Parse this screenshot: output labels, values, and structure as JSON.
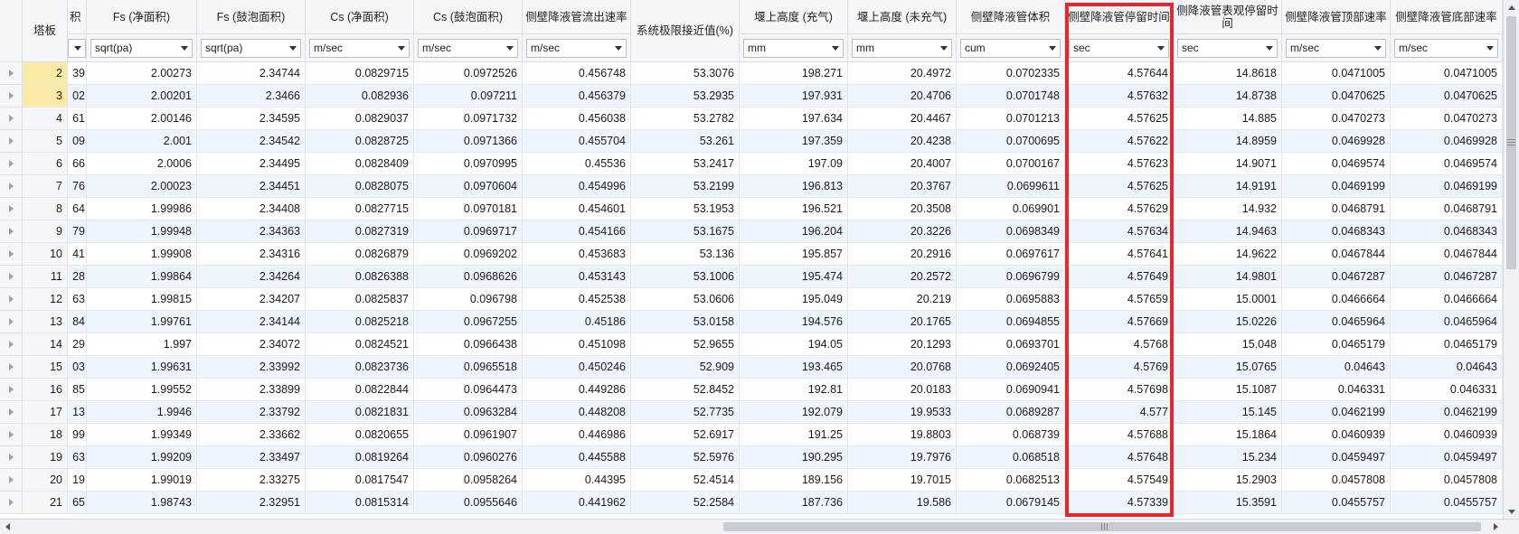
{
  "grid": {
    "tray_header": "塔板",
    "columns": [
      {
        "id": "c0",
        "label": "积",
        "unit": ""
      },
      {
        "id": "c1",
        "label": "Fs (净面积)",
        "unit": "sqrt(pa)"
      },
      {
        "id": "c2",
        "label": "Fs (鼓泡面积)",
        "unit": "sqrt(pa)"
      },
      {
        "id": "c3",
        "label": "Cs (净面积)",
        "unit": "m/sec"
      },
      {
        "id": "c4",
        "label": "Cs (鼓泡面积)",
        "unit": "m/sec"
      },
      {
        "id": "c5",
        "label": "侧壁降液管流出速率",
        "unit": "m/sec"
      },
      {
        "id": "c6",
        "label": "系统极限接近值(%)",
        "unit": ""
      },
      {
        "id": "c7",
        "label": "堰上高度 (充气)",
        "unit": "mm"
      },
      {
        "id": "c8",
        "label": "堰上高度 (未充气)",
        "unit": "mm"
      },
      {
        "id": "c9",
        "label": "侧壁降液管体积",
        "unit": "cum"
      },
      {
        "id": "c10",
        "label": "侧壁降液管停留时间",
        "unit": "sec"
      },
      {
        "id": "c11",
        "label": "侧降液管表观停留时间",
        "unit": "sec"
      },
      {
        "id": "c12",
        "label": "侧壁降液管顶部速率",
        "unit": "m/sec"
      },
      {
        "id": "c13",
        "label": "侧壁降液管底部速率",
        "unit": "m/sec"
      }
    ],
    "rows": [
      {
        "tray": "2",
        "v": [
          "39",
          "2.00273",
          "2.34744",
          "0.0829715",
          "0.0972526",
          "0.456748",
          "53.3076",
          "198.271",
          "20.4972",
          "0.0702335",
          "4.57644",
          "14.8618",
          "0.0471005",
          "0.0471005"
        ]
      },
      {
        "tray": "3",
        "v": [
          "02",
          "2.00201",
          "2.3466",
          "0.082936",
          "0.097211",
          "0.456379",
          "53.2935",
          "197.931",
          "20.4706",
          "0.0701748",
          "4.57632",
          "14.8738",
          "0.0470625",
          "0.0470625"
        ]
      },
      {
        "tray": "4",
        "v": [
          "61",
          "2.00146",
          "2.34595",
          "0.0829037",
          "0.0971732",
          "0.456038",
          "53.2782",
          "197.634",
          "20.4467",
          "0.0701213",
          "4.57625",
          "14.885",
          "0.0470273",
          "0.0470273"
        ]
      },
      {
        "tray": "5",
        "v": [
          "09",
          "2.001",
          "2.34542",
          "0.0828725",
          "0.0971366",
          "0.455704",
          "53.261",
          "197.359",
          "20.4238",
          "0.0700695",
          "4.57622",
          "14.8959",
          "0.0469928",
          "0.0469928"
        ]
      },
      {
        "tray": "6",
        "v": [
          "66",
          "2.0006",
          "2.34495",
          "0.0828409",
          "0.0970995",
          "0.45536",
          "53.2417",
          "197.09",
          "20.4007",
          "0.0700167",
          "4.57623",
          "14.9071",
          "0.0469574",
          "0.0469574"
        ]
      },
      {
        "tray": "7",
        "v": [
          "76",
          "2.00023",
          "2.34451",
          "0.0828075",
          "0.0970604",
          "0.454996",
          "53.2199",
          "196.813",
          "20.3767",
          "0.0699611",
          "4.57625",
          "14.9191",
          "0.0469199",
          "0.0469199"
        ]
      },
      {
        "tray": "8",
        "v": [
          "64",
          "1.99986",
          "2.34408",
          "0.0827715",
          "0.0970181",
          "0.454601",
          "53.1953",
          "196.521",
          "20.3508",
          "0.069901",
          "4.57629",
          "14.932",
          "0.0468791",
          "0.0468791"
        ]
      },
      {
        "tray": "9",
        "v": [
          "79",
          "1.99948",
          "2.34363",
          "0.0827319",
          "0.0969717",
          "0.454166",
          "53.1675",
          "196.204",
          "20.3226",
          "0.0698349",
          "4.57634",
          "14.9463",
          "0.0468343",
          "0.0468343"
        ]
      },
      {
        "tray": "10",
        "v": [
          "41",
          "1.99908",
          "2.34316",
          "0.0826879",
          "0.0969202",
          "0.453683",
          "53.136",
          "195.857",
          "20.2916",
          "0.0697617",
          "4.57641",
          "14.9622",
          "0.0467844",
          "0.0467844"
        ]
      },
      {
        "tray": "11",
        "v": [
          "28",
          "1.99864",
          "2.34264",
          "0.0826388",
          "0.0968626",
          "0.453143",
          "53.1006",
          "195.474",
          "20.2572",
          "0.0696799",
          "4.57649",
          "14.9801",
          "0.0467287",
          "0.0467287"
        ]
      },
      {
        "tray": "12",
        "v": [
          "63",
          "1.99815",
          "2.34207",
          "0.0825837",
          "0.096798",
          "0.452538",
          "53.0606",
          "195.049",
          "20.219",
          "0.0695883",
          "4.57659",
          "15.0001",
          "0.0466664",
          "0.0466664"
        ]
      },
      {
        "tray": "13",
        "v": [
          "84",
          "1.99761",
          "2.34144",
          "0.0825218",
          "0.0967255",
          "0.45186",
          "53.0158",
          "194.576",
          "20.1765",
          "0.0694855",
          "4.57669",
          "15.0226",
          "0.0465964",
          "0.0465964"
        ]
      },
      {
        "tray": "14",
        "v": [
          "29",
          "1.997",
          "2.34072",
          "0.0824521",
          "0.0966438",
          "0.451098",
          "52.9655",
          "194.05",
          "20.1293",
          "0.0693701",
          "4.5768",
          "15.048",
          "0.0465179",
          "0.0465179"
        ]
      },
      {
        "tray": "15",
        "v": [
          "03",
          "1.99631",
          "2.33992",
          "0.0823736",
          "0.0965518",
          "0.450246",
          "52.909",
          "193.465",
          "20.0768",
          "0.0692405",
          "4.5769",
          "15.0765",
          "0.04643",
          "0.04643"
        ]
      },
      {
        "tray": "16",
        "v": [
          "85",
          "1.99552",
          "2.33899",
          "0.0822844",
          "0.0964473",
          "0.449286",
          "52.8452",
          "192.81",
          "20.0183",
          "0.0690941",
          "4.57698",
          "15.1087",
          "0.046331",
          "0.046331"
        ]
      },
      {
        "tray": "17",
        "v": [
          "13",
          "1.9946",
          "2.33792",
          "0.0821831",
          "0.0963284",
          "0.448208",
          "52.7735",
          "192.079",
          "19.9533",
          "0.0689287",
          "4.577",
          "15.145",
          "0.0462199",
          "0.0462199"
        ]
      },
      {
        "tray": "18",
        "v": [
          "99",
          "1.99349",
          "2.33662",
          "0.0820655",
          "0.0961907",
          "0.446986",
          "52.6917",
          "191.25",
          "19.8803",
          "0.068739",
          "4.57688",
          "15.1864",
          "0.0460939",
          "0.0460939"
        ]
      },
      {
        "tray": "19",
        "v": [
          "63",
          "1.99209",
          "2.33497",
          "0.0819264",
          "0.0960276",
          "0.445588",
          "52.5976",
          "190.295",
          "19.7976",
          "0.068518",
          "4.57648",
          "15.234",
          "0.0459497",
          "0.0459497"
        ]
      },
      {
        "tray": "20",
        "v": [
          "19",
          "1.99019",
          "2.33275",
          "0.0817547",
          "0.0958264",
          "0.44395",
          "52.4514",
          "189.156",
          "19.7015",
          "0.0682513",
          "4.57549",
          "15.2903",
          "0.0457808",
          "0.0457808"
        ]
      },
      {
        "tray": "21",
        "v": [
          "65",
          "1.98743",
          "2.32951",
          "0.0815314",
          "0.0955646",
          "0.441962",
          "52.2584",
          "187.736",
          "19.586",
          "0.0679145",
          "4.57339",
          "15.3591",
          "0.0455757",
          "0.0455757"
        ]
      }
    ],
    "highlighted_trays": [
      "2",
      "3"
    ],
    "highlight_column": "侧壁降液管停留时间",
    "highlight_color": "#e8262b",
    "selected_tray_color": "#fbe9a6",
    "alt_row_color": "#eef4fb"
  }
}
